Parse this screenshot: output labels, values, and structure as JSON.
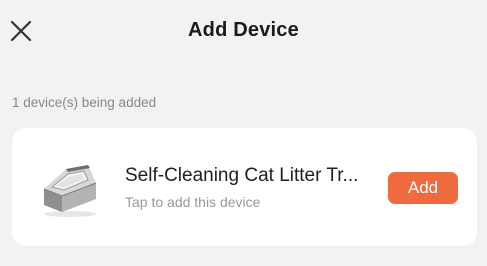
{
  "header": {
    "title": "Add Device",
    "close_icon": "close-icon"
  },
  "status": {
    "text": "1 device(s) being added"
  },
  "device": {
    "name": "Self-Cleaning Cat Litter Tr...",
    "hint": "Tap to add this device",
    "image_icon": "litter-box-icon",
    "add_label": "Add"
  },
  "colors": {
    "background": "#f2f2f2",
    "card": "#ffffff",
    "accent": "#ef6a3e",
    "title_text": "#1a1a1a",
    "secondary_text": "#888888"
  }
}
